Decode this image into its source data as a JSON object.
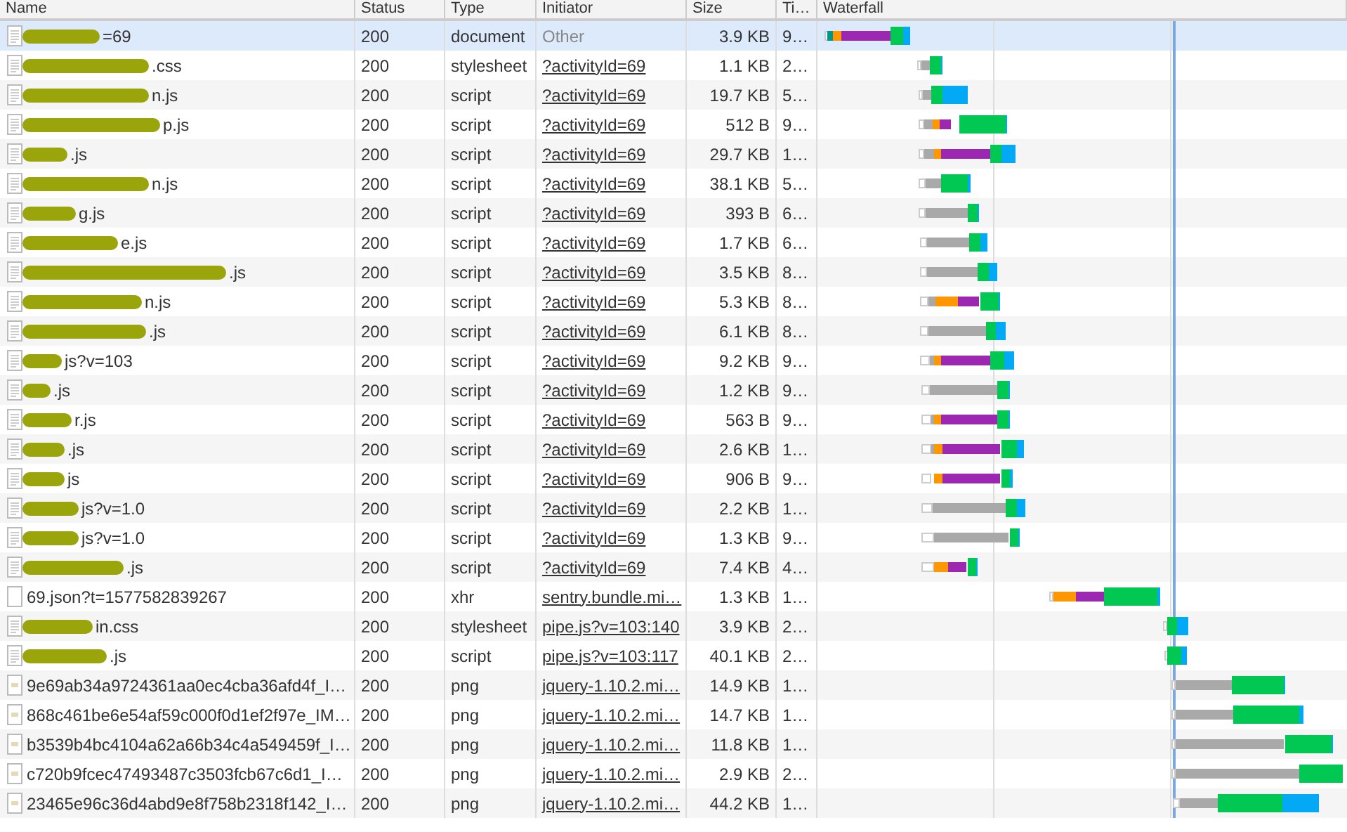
{
  "columns": [
    "Name",
    "Status",
    "Type",
    "Initiator",
    "Size",
    "Ti…",
    "Waterfall"
  ],
  "rows": [
    {
      "name": "=69",
      "status": "200",
      "type": "document",
      "initiator": "Other",
      "initiator_link": false,
      "size": "3.9 KB",
      "time": "9…",
      "selected": true
    },
    {
      "name": ".css",
      "status": "200",
      "type": "stylesheet",
      "initiator": "?activityId=69",
      "initiator_link": true,
      "size": "1.1 KB",
      "time": "2…",
      "selected": false
    },
    {
      "name": "n.js",
      "status": "200",
      "type": "script",
      "initiator": "?activityId=69",
      "initiator_link": true,
      "size": "19.7 KB",
      "time": "5…",
      "selected": false
    },
    {
      "name": "p.js",
      "status": "200",
      "type": "script",
      "initiator": "?activityId=69",
      "initiator_link": true,
      "size": "512 B",
      "time": "9…",
      "selected": false
    },
    {
      "name": ".js",
      "status": "200",
      "type": "script",
      "initiator": "?activityId=69",
      "initiator_link": true,
      "size": "29.7 KB",
      "time": "1…",
      "selected": false
    },
    {
      "name": "n.js",
      "status": "200",
      "type": "script",
      "initiator": "?activityId=69",
      "initiator_link": true,
      "size": "38.1 KB",
      "time": "5…",
      "selected": false
    },
    {
      "name": "g.js",
      "status": "200",
      "type": "script",
      "initiator": "?activityId=69",
      "initiator_link": true,
      "size": "393 B",
      "time": "6…",
      "selected": false
    },
    {
      "name": "e.js",
      "status": "200",
      "type": "script",
      "initiator": "?activityId=69",
      "initiator_link": true,
      "size": "1.7 KB",
      "time": "6…",
      "selected": false
    },
    {
      "name": ".js",
      "status": "200",
      "type": "script",
      "initiator": "?activityId=69",
      "initiator_link": true,
      "size": "3.5 KB",
      "time": "8…",
      "selected": false
    },
    {
      "name": "n.js",
      "status": "200",
      "type": "script",
      "initiator": "?activityId=69",
      "initiator_link": true,
      "size": "5.3 KB",
      "time": "8…",
      "selected": false
    },
    {
      "name": ".js",
      "status": "200",
      "type": "script",
      "initiator": "?activityId=69",
      "initiator_link": true,
      "size": "6.1 KB",
      "time": "8…",
      "selected": false
    },
    {
      "name": "js?v=103",
      "status": "200",
      "type": "script",
      "initiator": "?activityId=69",
      "initiator_link": true,
      "size": "9.2 KB",
      "time": "9…",
      "selected": false
    },
    {
      "name": ".js",
      "status": "200",
      "type": "script",
      "initiator": "?activityId=69",
      "initiator_link": true,
      "size": "1.2 KB",
      "time": "9…",
      "selected": false
    },
    {
      "name": "r.js",
      "status": "200",
      "type": "script",
      "initiator": "?activityId=69",
      "initiator_link": true,
      "size": "563 B",
      "time": "9…",
      "selected": false
    },
    {
      "name": ".js",
      "status": "200",
      "type": "script",
      "initiator": "?activityId=69",
      "initiator_link": true,
      "size": "2.6 KB",
      "time": "1…",
      "selected": false
    },
    {
      "name": "js",
      "status": "200",
      "type": "script",
      "initiator": "?activityId=69",
      "initiator_link": true,
      "size": "906 B",
      "time": "9…",
      "selected": false
    },
    {
      "name": "js?v=1.0",
      "status": "200",
      "type": "script",
      "initiator": "?activityId=69",
      "initiator_link": true,
      "size": "2.2 KB",
      "time": "1…",
      "selected": false
    },
    {
      "name": "js?v=1.0",
      "status": "200",
      "type": "script",
      "initiator": "?activityId=69",
      "initiator_link": true,
      "size": "1.3 KB",
      "time": "9…",
      "selected": false
    },
    {
      "name": ".js",
      "status": "200",
      "type": "script",
      "initiator": "?activityId=69",
      "initiator_link": true,
      "size": "7.4 KB",
      "time": "4…",
      "selected": false
    },
    {
      "name": "69.json?t=1577582839267",
      "status": "200",
      "type": "xhr",
      "initiator": "sentry.bundle.mi…",
      "initiator_link": true,
      "size": "1.3 KB",
      "time": "1…",
      "selected": false
    },
    {
      "name": "in.css",
      "status": "200",
      "type": "stylesheet",
      "initiator": "pipe.js?v=103:140",
      "initiator_link": true,
      "size": "3.9 KB",
      "time": "2…",
      "selected": false
    },
    {
      "name": ".js",
      "status": "200",
      "type": "script",
      "initiator": "pipe.js?v=103:117",
      "initiator_link": true,
      "size": "40.1 KB",
      "time": "2…",
      "selected": false
    },
    {
      "name": "9e69ab34a9724361aa0ec4cba36afd4f_I…",
      "status": "200",
      "type": "png",
      "initiator": "jquery-1.10.2.mi…",
      "initiator_link": true,
      "size": "14.9 KB",
      "time": "1…",
      "selected": false
    },
    {
      "name": "868c461be6e54af59c000f0d1ef2f97e_IM…",
      "status": "200",
      "type": "png",
      "initiator": "jquery-1.10.2.mi…",
      "initiator_link": true,
      "size": "14.7 KB",
      "time": "1…",
      "selected": false
    },
    {
      "name": "b3539b4bc4104a62a66b34c4a549459f_I…",
      "status": "200",
      "type": "png",
      "initiator": "jquery-1.10.2.mi…",
      "initiator_link": true,
      "size": "11.8 KB",
      "time": "1…",
      "selected": false
    },
    {
      "name": "c720b9fcec47493487c3503fcb67c6d1_I…",
      "status": "200",
      "type": "png",
      "initiator": "jquery-1.10.2.mi…",
      "initiator_link": true,
      "size": "2.9 KB",
      "time": "2…",
      "selected": false
    },
    {
      "name": "23465e96c36d4abd9e8f758b2318f142_I…",
      "status": "200",
      "type": "png",
      "initiator": "jquery-1.10.2.mi…",
      "initiator_link": true,
      "size": "44.2 KB",
      "time": "1…",
      "selected": false
    }
  ]
}
